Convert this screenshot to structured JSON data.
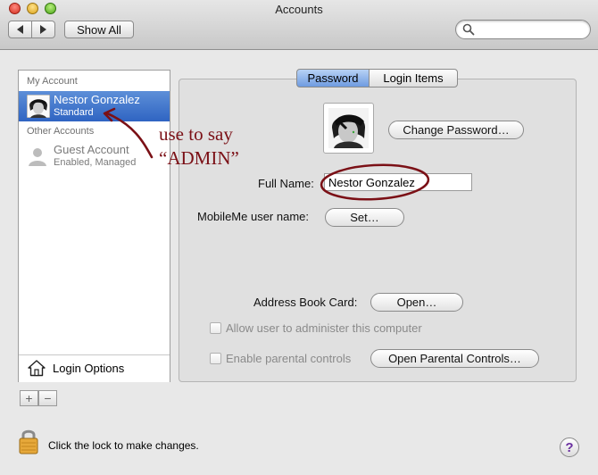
{
  "window": {
    "title": "Accounts"
  },
  "toolbar": {
    "show_all_label": "Show All",
    "search_placeholder": ""
  },
  "sidebar": {
    "my_account_header": "My Account",
    "other_accounts_header": "Other Accounts",
    "accounts": [
      {
        "name": "Nestor Gonzalez",
        "type": "Standard"
      },
      {
        "name": "Guest Account",
        "type": "Enabled, Managed"
      }
    ],
    "login_options_label": "Login Options",
    "add_label": "+",
    "remove_label": "−"
  },
  "tabs": {
    "password": "Password",
    "login_items": "Login Items"
  },
  "panel": {
    "change_password_label": "Change Password…",
    "full_name_label": "Full Name:",
    "full_name_value": "Nestor Gonzalez",
    "mobileme_label": "MobileMe user name:",
    "set_label": "Set…",
    "address_book_label": "Address Book Card:",
    "open_label": "Open…",
    "allow_admin_label": "Allow user to administer this computer",
    "parental_label": "Enable parental controls",
    "open_parental_label": "Open Parental Controls…"
  },
  "footer": {
    "lock_text": "Click the lock to make changes.",
    "help_label": "?"
  },
  "annotation": {
    "line1": "use to say",
    "line2": "“ADMIN”",
    "color": "#7b1016"
  },
  "colors": {
    "selection": "#3a6fc8",
    "annotation": "#7b1016"
  }
}
